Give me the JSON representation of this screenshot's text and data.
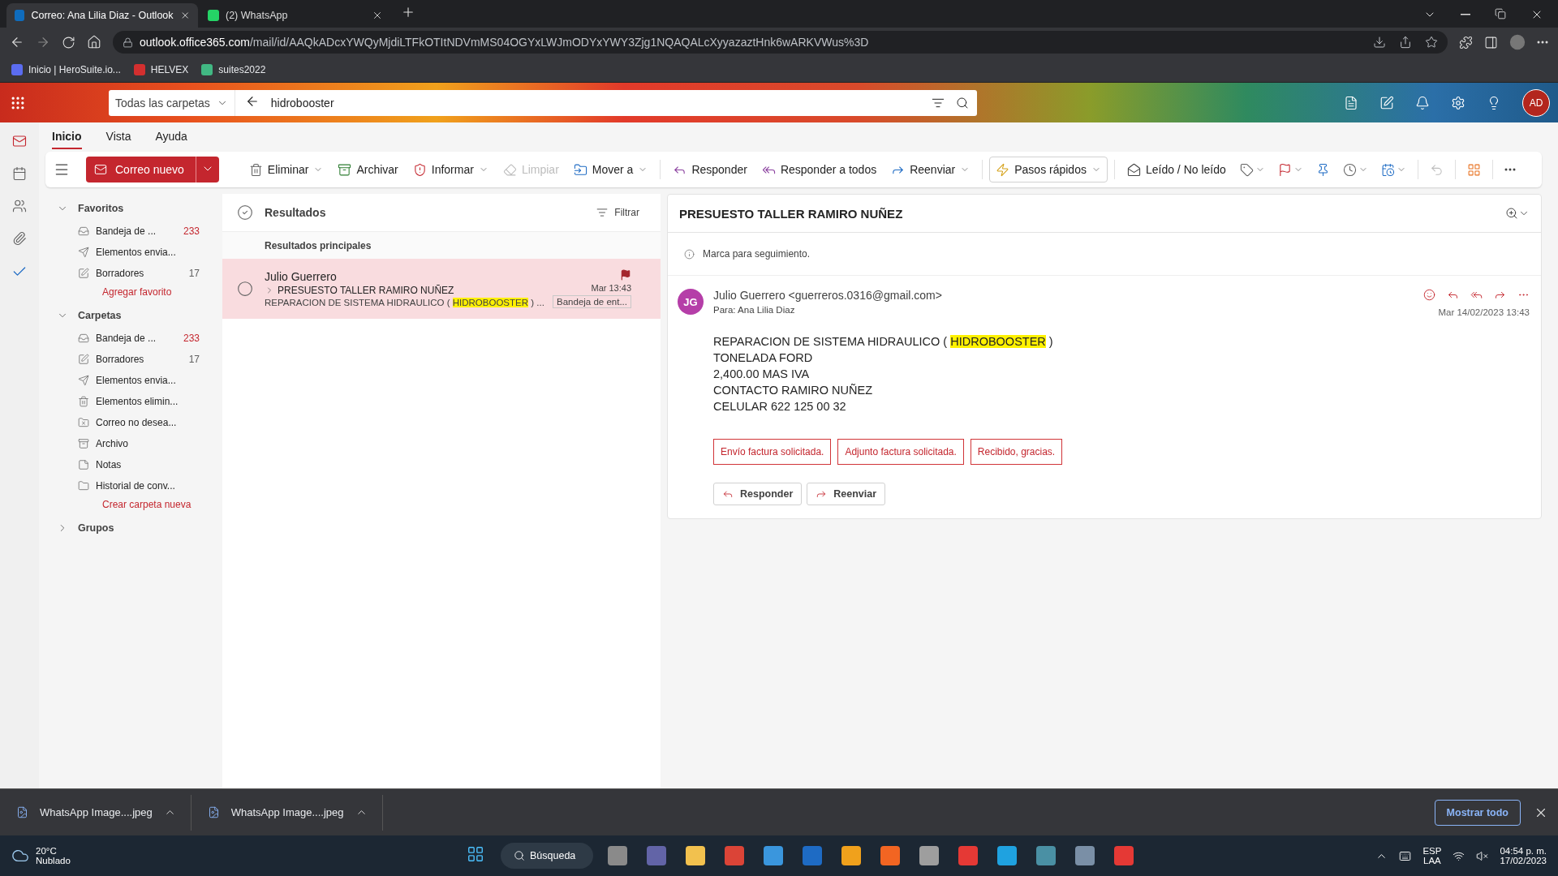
{
  "browser": {
    "tabs": [
      {
        "title": "Correo: Ana Lilia Diaz - Outlook",
        "selected": true,
        "kind": "outlook"
      },
      {
        "title": "(2) WhatsApp",
        "selected": false,
        "kind": "whatsapp"
      }
    ],
    "url_host": "outlook.office365.com",
    "url_path": "/mail/id/AAQkADcxYWQyMjdiLTFkOTItNDVmMS04OGYxLWJmODYxYWY3Zjg1NQAQALcXyyazaztHnk6wARKVWus%3D",
    "bookmarks": [
      {
        "label": "Inicio | HeroSuite.io...",
        "kind": "herosuite"
      },
      {
        "label": "HELVEX",
        "kind": "helvex"
      },
      {
        "label": "suites2022",
        "kind": "vue"
      }
    ]
  },
  "header": {
    "scope": "Todas las carpetas",
    "query": "hidrobooster",
    "avatar": "AD"
  },
  "ribbon": {
    "tabs": [
      {
        "label": "Inicio",
        "selected": true
      },
      {
        "label": "Vista",
        "selected": false
      },
      {
        "label": "Ayuda",
        "selected": false
      }
    ],
    "new_mail": "Correo nuevo",
    "actions": [
      {
        "label": "Eliminar",
        "dropdown": true,
        "disabled": false,
        "kind": "plain"
      },
      {
        "label": "Archivar",
        "dropdown": false,
        "disabled": false,
        "kind": "plain"
      },
      {
        "label": "Informar",
        "dropdown": true,
        "disabled": false,
        "kind": "plain"
      },
      {
        "label": "Limpiar",
        "dropdown": false,
        "disabled": true,
        "kind": "plain"
      },
      {
        "label": "Mover a",
        "dropdown": true,
        "disabled": false,
        "kind": "plain"
      },
      {
        "label": "Responder",
        "dropdown": false,
        "disabled": false,
        "kind": "plain"
      },
      {
        "label": "Responder a todos",
        "dropdown": false,
        "disabled": false,
        "kind": "plain"
      },
      {
        "label": "Reenviar",
        "dropdown": true,
        "disabled": false,
        "kind": "plain"
      },
      {
        "label": "Pasos rápidos",
        "dropdown": true,
        "disabled": false,
        "kind": "split"
      },
      {
        "label": "Leído / No leído",
        "dropdown": false,
        "disabled": false,
        "kind": "plain"
      }
    ]
  },
  "folders": [
    {
      "title": "Favoritos",
      "expanded": true,
      "items": [
        {
          "label": "Bandeja de ...",
          "kind": "inbox",
          "count": "233",
          "unread": true
        },
        {
          "label": "Elementos envia...",
          "kind": "sent"
        },
        {
          "label": "Borradores",
          "kind": "draft",
          "count": "17",
          "unread": false
        }
      ],
      "link": "Agregar favorito"
    },
    {
      "title": "Carpetas",
      "expanded": true,
      "items": [
        {
          "label": "Bandeja de ...",
          "kind": "inbox",
          "count": "233",
          "unread": true
        },
        {
          "label": "Borradores",
          "kind": "draft",
          "count": "17",
          "unread": false
        },
        {
          "label": "Elementos envia...",
          "kind": "sent"
        },
        {
          "label": "Elementos elimin...",
          "kind": "trash"
        },
        {
          "label": "Correo no desea...",
          "kind": "junk"
        },
        {
          "label": "Archivo",
          "kind": "archive"
        },
        {
          "label": "Notas",
          "kind": "note"
        },
        {
          "label": "Historial de conv...",
          "kind": "folder"
        }
      ],
      "link": "Crear carpeta nueva"
    },
    {
      "title": "Grupos",
      "expanded": false
    }
  ],
  "results": {
    "title": "Resultados",
    "filter": "Filtrar",
    "group": "Resultados principales",
    "messages": [
      {
        "sender": "Julio Guerrero",
        "subject": "PRESUESTO TALLER RAMIRO NUÑEZ",
        "preview": [
          {
            "text": "REPARACION DE SISTEMA HIDRAULICO ( ",
            "highlight": false
          },
          {
            "text": "HIDROBOOSTER",
            "highlight": true
          },
          {
            "text": " ) ...",
            "highlight": false
          }
        ],
        "time": "Mar 13:43",
        "folder": "Bandeja de ent...",
        "flagged": true,
        "selected": true
      }
    ]
  },
  "reading": {
    "subject": "PRESUESTO TALLER RAMIRO NUÑEZ",
    "notice": "Marca para seguimiento.",
    "initials": "JG",
    "from": "Julio Guerrero <guerreros.0316@gmail.com>",
    "to_label": "Para:",
    "to": "Ana Lilia Diaz",
    "date": "Mar 14/02/2023 13:43",
    "body": [
      {
        "parts": [
          {
            "text": "REPARACION DE SISTEMA HIDRAULICO ( ",
            "highlight": false
          },
          {
            "text": "HIDROBOOSTER",
            "highlight": true
          },
          {
            "text": " )",
            "highlight": false
          }
        ]
      },
      {
        "parts": [
          {
            "text": "TONELADA FORD",
            "highlight": false
          }
        ]
      },
      {
        "parts": [
          {
            "text": "2,400.00 MAS IVA",
            "highlight": false
          }
        ]
      },
      {
        "parts": [
          {
            "text": "CONTACTO RAMIRO NUÑEZ",
            "highlight": false
          }
        ]
      },
      {
        "parts": [
          {
            "text": "CELULAR 622 125 00 32",
            "highlight": false
          }
        ]
      }
    ],
    "suggested_replies": [
      "Envío factura solicitada.",
      "Adjunto factura solicitada.",
      "Recibido, gracias."
    ],
    "actions": [
      "Responder",
      "Reenviar"
    ]
  },
  "downloads": {
    "items": [
      "WhatsApp Image....jpeg",
      "WhatsApp Image....jpeg"
    ],
    "show_all": "Mostrar todo"
  },
  "taskbar": {
    "temperature": "20°C",
    "condition": "Nublado",
    "search": "Búsqueda",
    "lang": "ESP",
    "layout": "LAA",
    "time": "04:54 p. m.",
    "date": "17/02/2023"
  }
}
